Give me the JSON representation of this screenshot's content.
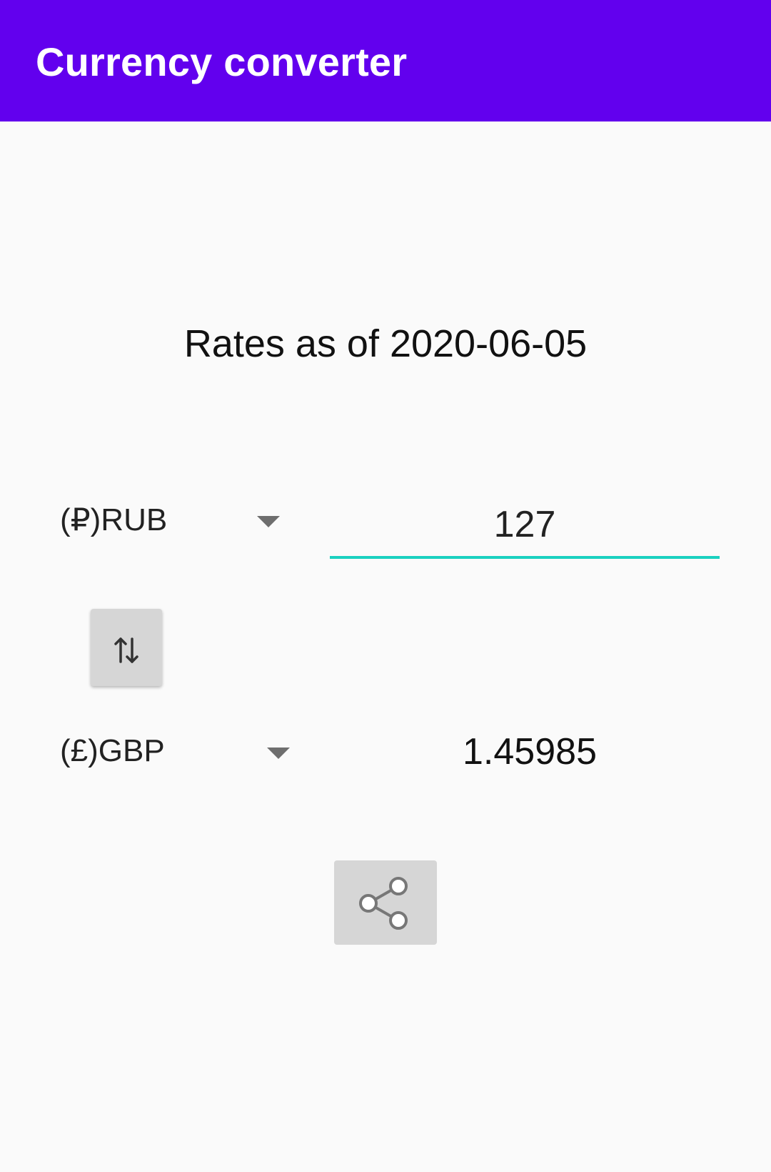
{
  "app_bar": {
    "title": "Currency converter",
    "background_color": "#6200ee"
  },
  "rates": {
    "date_text": "Rates as of 2020-06-05"
  },
  "from": {
    "currency_label": "(₽)RUB",
    "amount_value": "127",
    "dropdown_icon": "caret-down-icon",
    "underline_color": "#1ad1c0"
  },
  "swap": {
    "icon": "swap-vertical-icon"
  },
  "to": {
    "currency_label": "(£)GBP",
    "result_value": "1.45985",
    "dropdown_icon": "caret-down-icon"
  },
  "share": {
    "icon": "share-icon"
  }
}
